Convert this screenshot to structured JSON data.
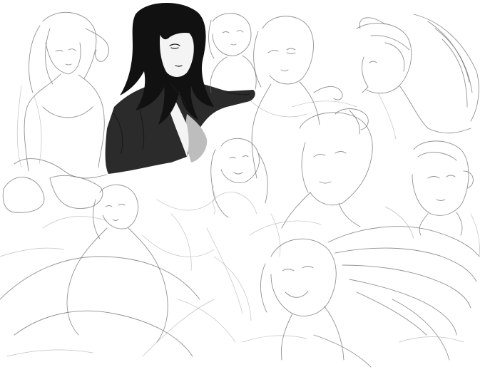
{
  "canvas": {
    "background": "#ffffff",
    "pencil_color": "#6e6e6e",
    "ink_color": "#111111",
    "jacket_color": "#2b2b2b",
    "shade_color": "#bdbdbd"
  },
  "figures": [
    "sketch-girl-sitting",
    "sketch-inked-long-hair-jacket",
    "sketch-small-head-top",
    "sketch-winking-girl",
    "sketch-angel-profile-wings",
    "sketch-small-curly-girl",
    "sketch-undercut-boy",
    "sketch-short-hair-bun",
    "sketch-gown-figure",
    "sketch-smiling-boy-wings"
  ]
}
